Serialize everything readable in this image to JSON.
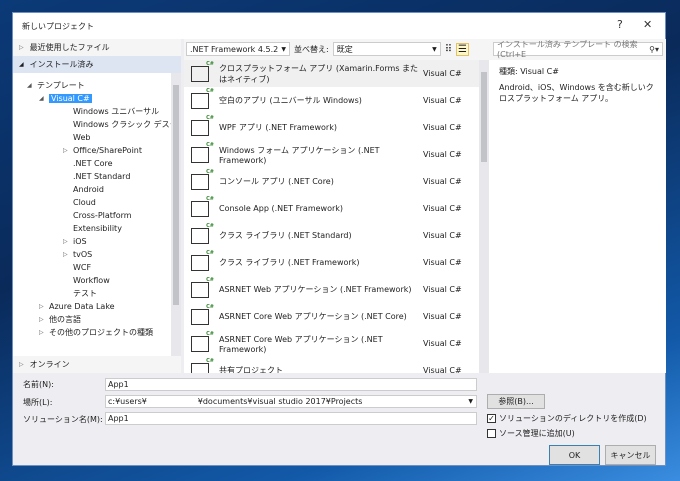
{
  "title": "新しいプロジェクト",
  "help": "?",
  "close": "✕",
  "left": {
    "recent": "最近使用したファイル",
    "installed": "インストール済み",
    "online": "オンライン",
    "tree": [
      {
        "label": "テンプレート",
        "level": 0,
        "arrow": "◢"
      },
      {
        "label": "Visual C#",
        "level": 1,
        "arrow": "◢",
        "selected": true
      },
      {
        "label": "Windows ユニバーサル",
        "level": 2
      },
      {
        "label": "Windows クラシック デスクトップ",
        "level": 2
      },
      {
        "label": "Web",
        "level": 2
      },
      {
        "label": "Office/SharePoint",
        "level": 2,
        "arrow": "▷"
      },
      {
        "label": ".NET Core",
        "level": 2
      },
      {
        "label": ".NET Standard",
        "level": 2
      },
      {
        "label": "Android",
        "level": 2
      },
      {
        "label": "Cloud",
        "level": 2
      },
      {
        "label": "Cross-Platform",
        "level": 2
      },
      {
        "label": "Extensibility",
        "level": 2
      },
      {
        "label": "iOS",
        "level": 2,
        "arrow": "▷"
      },
      {
        "label": "tvOS",
        "level": 2,
        "arrow": "▷"
      },
      {
        "label": "WCF",
        "level": 2
      },
      {
        "label": "Workflow",
        "level": 2
      },
      {
        "label": "テスト",
        "level": 2
      },
      {
        "label": "Azure Data Lake",
        "level": 1,
        "arrow": "▷"
      },
      {
        "label": "他の言語",
        "level": 1,
        "arrow": "▷"
      },
      {
        "label": "その他のプロジェクトの種類",
        "level": 1,
        "arrow": "▷"
      }
    ]
  },
  "toolbar": {
    "framework": ".NET Framework 4.5.2",
    "sort_label": "並べ替え:",
    "sort_value": "既定",
    "search_placeholder": "インストール済み テンプレート の検索 (Ctrl+E"
  },
  "templates": [
    {
      "name": "クロスプラットフォーム アプリ (Xamarin.Forms またはネイティブ)",
      "lang": "Visual C#"
    },
    {
      "name": "空白のアプリ (ユニバーサル Windows)",
      "lang": "Visual C#"
    },
    {
      "name": "WPF アプリ (.NET Framework)",
      "lang": "Visual C#"
    },
    {
      "name": "Windows フォーム アプリケーション (.NET Framework)",
      "lang": "Visual C#"
    },
    {
      "name": "コンソール アプリ (.NET Core)",
      "lang": "Visual C#"
    },
    {
      "name": "Console App (.NET Framework)",
      "lang": "Visual C#"
    },
    {
      "name": "クラス ライブラリ (.NET Standard)",
      "lang": "Visual C#"
    },
    {
      "name": "クラス ライブラリ (.NET Framework)",
      "lang": "Visual C#"
    },
    {
      "name": "ASRNET Web アプリケーション (.NET Framework)",
      "lang": "Visual C#"
    },
    {
      "name": "ASRNET Core Web アプリケーション (.NET Core)",
      "lang": "Visual C#"
    },
    {
      "name": "ASRNET Core Web アプリケーション (.NET Framework)",
      "lang": "Visual C#"
    },
    {
      "name": "共有プロジェクト",
      "lang": "Visual C#"
    }
  ],
  "detail": {
    "type": "種類:  Visual C#",
    "description": "Android、iOS、Windows を含む新しいクロスプラットフォーム アプリ。"
  },
  "form": {
    "name_label": "名前(N):",
    "name_value": "App1",
    "location_label": "場所(L):",
    "location_value": "c:¥users¥                    ¥documents¥visual studio 2017¥Projects",
    "solution_label": "ソリューション名(M):",
    "solution_value": "App1",
    "browse": "参照(B)...",
    "create_dir": "ソリューションのディレクトリを作成(D)",
    "source_control": "ソース管理に追加(U)",
    "ok": "OK",
    "cancel": "キャンセル"
  }
}
